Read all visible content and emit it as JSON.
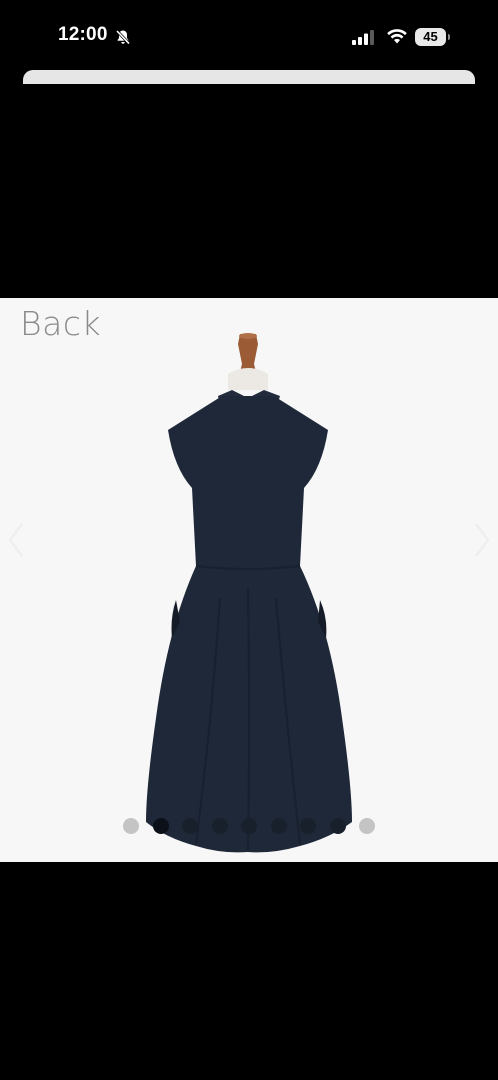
{
  "status_bar": {
    "time": "12:00",
    "battery_level": "45",
    "icons": [
      "bell-slash-icon",
      "cellular-signal-icon",
      "wifi-icon",
      "battery-icon"
    ]
  },
  "product_image": {
    "view_label": "Back",
    "background_color": "#f7f7f7",
    "dress_color": "#1f2838",
    "carousel": {
      "total": 9,
      "active_index": 1
    },
    "icons": [
      "mannequin-image",
      "chevron-left-icon",
      "chevron-right-icon"
    ]
  }
}
